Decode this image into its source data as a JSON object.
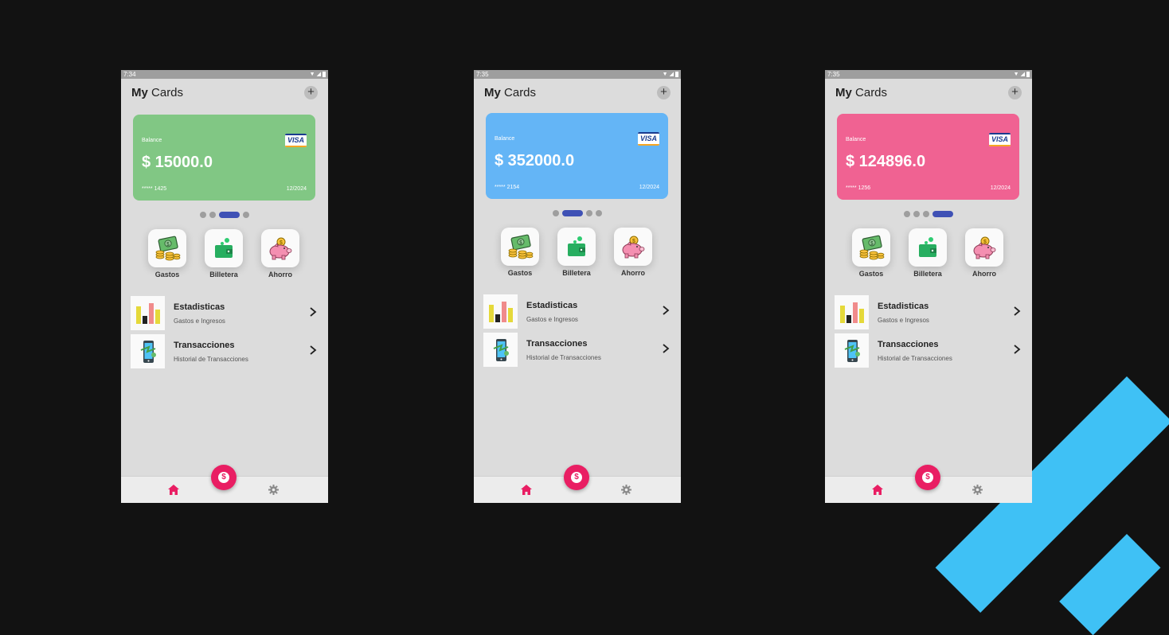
{
  "colors": {
    "background": "#121212",
    "accent_stripe": "#3fc1f5",
    "fab": "#e91e63",
    "indicator_active": "#3f51b5"
  },
  "screens": [
    {
      "status": {
        "time": "7:34"
      },
      "header": {
        "title_bold": "My",
        "title_rest": "Cards"
      },
      "card": {
        "color": "#81c784",
        "balance_label": "Balance",
        "amount": "$ 15000.0",
        "number": "***** 1425",
        "expiry": "12/2024",
        "brand": "VISA"
      },
      "active_indicator": 2,
      "actions": [
        {
          "label": "Gastos",
          "icon": "money-coins-icon"
        },
        {
          "label": "Billetera",
          "icon": "wallet-icon"
        },
        {
          "label": "Ahorro",
          "icon": "piggy-bank-icon"
        }
      ],
      "menu": [
        {
          "title": "Estadisticas",
          "subtitle": "Gastos e Ingresos",
          "icon": "bar-chart-icon"
        },
        {
          "title": "Transacciones",
          "subtitle": "Historial de Transacciones",
          "icon": "phone-transfer-icon"
        }
      ],
      "nav": {
        "fab_symbol": "$",
        "home_icon": "home-icon",
        "settings_icon": "gear-icon"
      }
    },
    {
      "status": {
        "time": "7:35"
      },
      "header": {
        "title_bold": "My",
        "title_rest": "Cards"
      },
      "card": {
        "color": "#64b5f6",
        "balance_label": "Balance",
        "amount": "$ 352000.0",
        "number": "***** 2154",
        "expiry": "12/2024",
        "brand": "VISA"
      },
      "active_indicator": 1,
      "actions": [
        {
          "label": "Gastos",
          "icon": "money-coins-icon"
        },
        {
          "label": "Billetera",
          "icon": "wallet-icon"
        },
        {
          "label": "Ahorro",
          "icon": "piggy-bank-icon"
        }
      ],
      "menu": [
        {
          "title": "Estadisticas",
          "subtitle": "Gastos e Ingresos",
          "icon": "bar-chart-icon"
        },
        {
          "title": "Transacciones",
          "subtitle": "Historial de Transacciones",
          "icon": "phone-transfer-icon"
        }
      ],
      "nav": {
        "fab_symbol": "$",
        "home_icon": "home-icon",
        "settings_icon": "gear-icon"
      }
    },
    {
      "status": {
        "time": "7:35"
      },
      "header": {
        "title_bold": "My",
        "title_rest": "Cards"
      },
      "card": {
        "color": "#f06292",
        "balance_label": "Balance",
        "amount": "$ 124896.0",
        "number": "***** 1256",
        "expiry": "12/2024",
        "brand": "VISA"
      },
      "active_indicator": 3,
      "actions": [
        {
          "label": "Gastos",
          "icon": "money-coins-icon"
        },
        {
          "label": "Billetera",
          "icon": "wallet-icon"
        },
        {
          "label": "Ahorro",
          "icon": "piggy-bank-icon"
        }
      ],
      "menu": [
        {
          "title": "Estadisticas",
          "subtitle": "Gastos e Ingresos",
          "icon": "bar-chart-icon"
        },
        {
          "title": "Transacciones",
          "subtitle": "Historial de Transacciones",
          "icon": "phone-transfer-icon"
        }
      ],
      "nav": {
        "fab_symbol": "$",
        "home_icon": "home-icon",
        "settings_icon": "gear-icon"
      }
    }
  ]
}
